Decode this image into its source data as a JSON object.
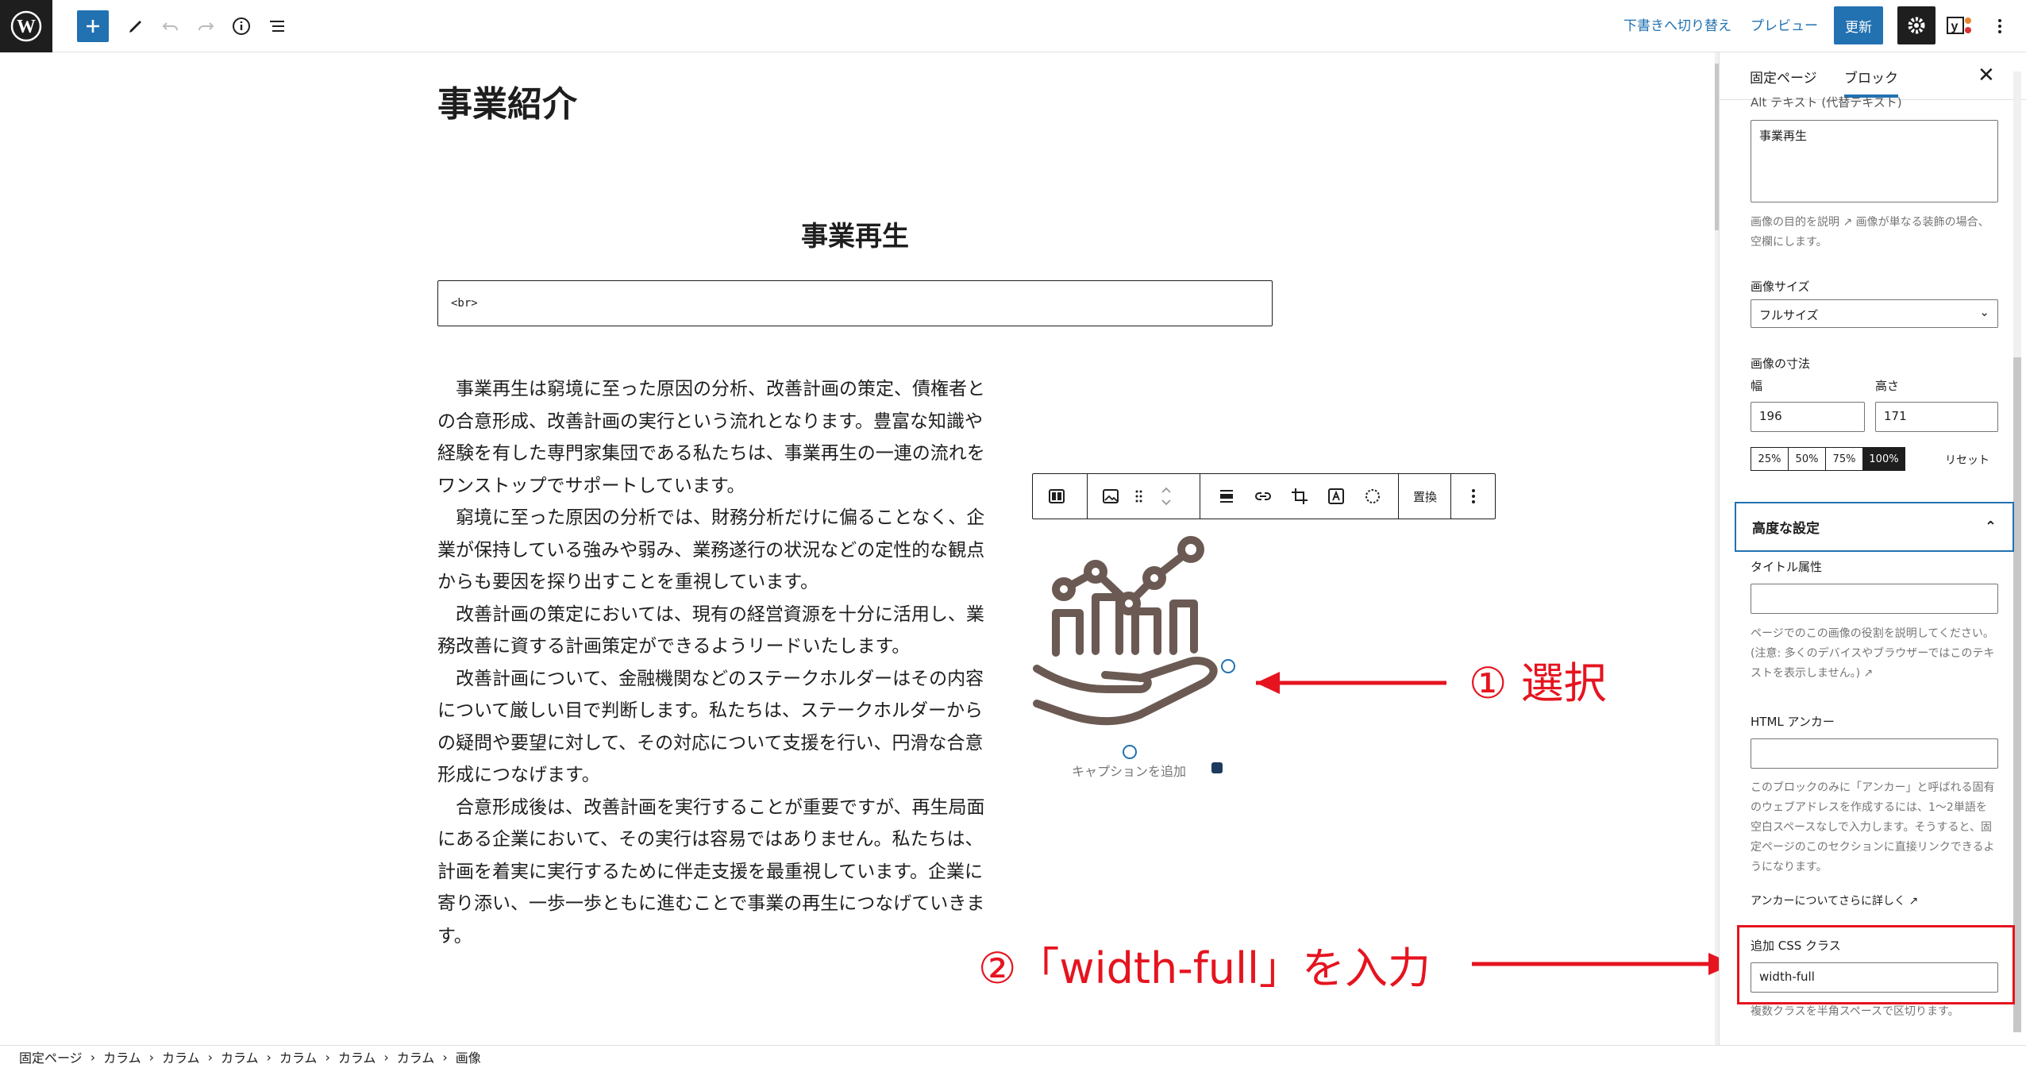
{
  "header": {
    "switch_to_draft": "下書きへ切り替え",
    "preview": "プレビュー",
    "update": "更新",
    "yoast_icon": "yoast-icon"
  },
  "content": {
    "page_title": "事業紹介",
    "heading": "事業再生",
    "html_block": "<br>",
    "paragraphs": [
      "事業再生は窮境に至った原因の分析、改善計画の策定、債権者との合意形成、改善計画の実行という流れとなります。豊富な知識や経験を有した専門家集団である私たちは、事業再生の一連の流れをワンストップでサポートしています。",
      "窮境に至った原因の分析では、財務分析だけに偏ることなく、企業が保持している強みや弱み、業務遂行の状況などの定性的な観点からも要因を探り出すことを重視しています。",
      "改善計画の策定においては、現有の経営資源を十分に活用し、業務改善に資する計画策定ができるようリードいたします。",
      "改善計画について、金融機関などのステークホルダーはその内容について厳しい目で判断します。私たちは、ステークホルダーからの疑問や要望に対して、その対応について支援を行い、円滑な合意形成につなげます。",
      "合意形成後は、改善計画を実行することが重要ですが、再生局面にある企業において、その実行は容易ではありません。私たちは、計画を着実に実行するために伴走支援を最重視しています。企業に寄り添い、一歩一歩ともに進むことで事業の再生につなげていきます。"
    ],
    "replace_label": "置換",
    "caption_placeholder": "キャプションを追加"
  },
  "annotations": {
    "step1": "① 選択",
    "step2": "②「width-full」を入力"
  },
  "sidebar": {
    "tab_page": "固定ページ",
    "tab_block": "ブロック",
    "alt_label": "Alt テキスト (代替テキスト)",
    "alt_value": "事業再生",
    "alt_help": "画像の目的を説明 ↗ 画像が単なる装飾の場合、空欄にします。",
    "image_size_label": "画像サイズ",
    "image_size_value": "フルサイズ",
    "dimensions_label": "画像の寸法",
    "width_label": "幅",
    "height_label": "高さ",
    "width_value": "196",
    "height_value": "171",
    "size_buttons": [
      "25%",
      "50%",
      "75%",
      "100%"
    ],
    "reset": "リセット",
    "advanced": "高度な設定",
    "title_attr_label": "タイトル属性",
    "title_attr_help": "ページでのこの画像の役割を説明してください。(注意: 多くのデバイスやブラウザーではこのテキストを表示しません。) ↗",
    "html_anchor_label": "HTML アンカー",
    "html_anchor_help": "このブロックのみに「アンカー」と呼ばれる固有のウェブアドレスを作成するには、1〜2単語を空白スペースなしで入力します。そうすると、固定ページのこのセクションに直接リンクできるようになります。",
    "anchor_more": "アンカーについてさらに詳しく ↗",
    "css_class_label": "追加 CSS クラス",
    "css_class_value": "width-full",
    "css_class_help": "複数クラスを半角スペースで区切ります。"
  },
  "breadcrumb": [
    "固定ページ",
    "カラム",
    "カラム",
    "カラム",
    "カラム",
    "カラム",
    "カラム",
    "画像"
  ],
  "colors": {
    "accent": "#2271b1",
    "annotation": "#e5141f",
    "dark": "#1e1e1e"
  }
}
